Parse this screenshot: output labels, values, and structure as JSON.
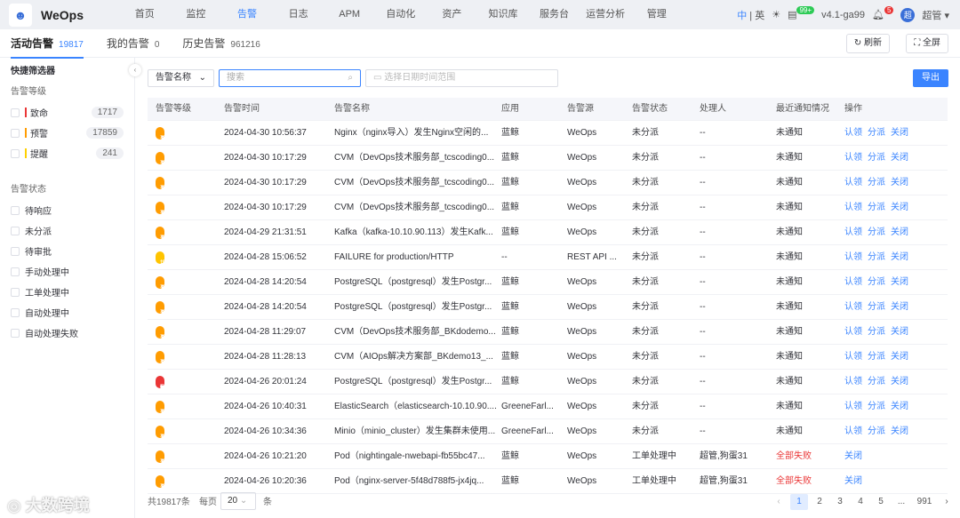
{
  "header": {
    "brand": "WeOps",
    "nav": [
      "首页",
      "监控",
      "告警",
      "日志",
      "APM",
      "自动化",
      "资产",
      "知识库",
      "服务台",
      "运营分析",
      "管理"
    ],
    "active_nav": "告警",
    "lang_zh": "中",
    "lang_sep": "|",
    "lang_en": "英",
    "msg_badge": "99+",
    "version": "v4.1-ga99",
    "notify_badge": "5",
    "avatar": "超",
    "user": "超管"
  },
  "tabs": [
    {
      "label": "活动告警",
      "count": "19817"
    },
    {
      "label": "我的告警",
      "count": "0"
    },
    {
      "label": "历史告警",
      "count": "961216"
    }
  ],
  "toolbar": {
    "refresh": "刷新",
    "fullscreen": "全屏",
    "export": "导出"
  },
  "sidebar": {
    "title": "快捷筛选器",
    "level_title": "告警等级",
    "levels": [
      {
        "label": "致命",
        "count": "1717",
        "color": "#ea3636"
      },
      {
        "label": "预警",
        "count": "17859",
        "color": "#ff9c01"
      },
      {
        "label": "提醒",
        "count": "241",
        "color": "#ffd000"
      }
    ],
    "status_title": "告警状态",
    "statuses": [
      "待响应",
      "未分派",
      "待审批",
      "手动处理中",
      "工单处理中",
      "自动处理中",
      "自动处理失败"
    ]
  },
  "filter": {
    "field": "告警名称",
    "search_placeholder": "搜索",
    "date_placeholder": "选择日期时间范围"
  },
  "table": {
    "columns": [
      "告警等级",
      "告警时间",
      "告警名称",
      "应用",
      "告警源",
      "告警状态",
      "处理人",
      "最近通知情况",
      "操作"
    ],
    "rows": [
      {
        "level": "预警",
        "time": "2024-04-30 10:56:37",
        "name": "Nginx（nginx导入）发生Nginx空闲的...",
        "app": "蓝鲸",
        "source": "WeOps",
        "status": "未分派",
        "handler": "--",
        "notify": "未通知",
        "ops": [
          "认领",
          "分派",
          "关闭"
        ]
      },
      {
        "level": "预警",
        "time": "2024-04-30 10:17:29",
        "name": "CVM（DevOps技术服务部_tcscoding0...",
        "app": "蓝鲸",
        "source": "WeOps",
        "status": "未分派",
        "handler": "--",
        "notify": "未通知",
        "ops": [
          "认领",
          "分派",
          "关闭"
        ]
      },
      {
        "level": "预警",
        "time": "2024-04-30 10:17:29",
        "name": "CVM（DevOps技术服务部_tcscoding0...",
        "app": "蓝鲸",
        "source": "WeOps",
        "status": "未分派",
        "handler": "--",
        "notify": "未通知",
        "ops": [
          "认领",
          "分派",
          "关闭"
        ]
      },
      {
        "level": "预警",
        "time": "2024-04-30 10:17:29",
        "name": "CVM（DevOps技术服务部_tcscoding0...",
        "app": "蓝鲸",
        "source": "WeOps",
        "status": "未分派",
        "handler": "--",
        "notify": "未通知",
        "ops": [
          "认领",
          "分派",
          "关闭"
        ]
      },
      {
        "level": "预警",
        "time": "2024-04-29 21:31:51",
        "name": "Kafka（kafka-10.10.90.113）发生Kafk...",
        "app": "蓝鲸",
        "source": "WeOps",
        "status": "未分派",
        "handler": "--",
        "notify": "未通知",
        "ops": [
          "认领",
          "分派",
          "关闭"
        ]
      },
      {
        "level": "提醒",
        "time": "2024-04-28 15:06:52",
        "name": "FAILURE for production/HTTP",
        "app": "--",
        "source": "REST API ...",
        "status": "未分派",
        "handler": "--",
        "notify": "未通知",
        "ops": [
          "认领",
          "分派",
          "关闭"
        ]
      },
      {
        "level": "预警",
        "time": "2024-04-28 14:20:54",
        "name": "PostgreSQL（postgresql）发生Postgr...",
        "app": "蓝鲸",
        "source": "WeOps",
        "status": "未分派",
        "handler": "--",
        "notify": "未通知",
        "ops": [
          "认领",
          "分派",
          "关闭"
        ]
      },
      {
        "level": "预警",
        "time": "2024-04-28 14:20:54",
        "name": "PostgreSQL（postgresql）发生Postgr...",
        "app": "蓝鲸",
        "source": "WeOps",
        "status": "未分派",
        "handler": "--",
        "notify": "未通知",
        "ops": [
          "认领",
          "分派",
          "关闭"
        ]
      },
      {
        "level": "预警",
        "time": "2024-04-28 11:29:07",
        "name": "CVM（DevOps技术服务部_BKdodemo...",
        "app": "蓝鲸",
        "source": "WeOps",
        "status": "未分派",
        "handler": "--",
        "notify": "未通知",
        "ops": [
          "认领",
          "分派",
          "关闭"
        ]
      },
      {
        "level": "预警",
        "time": "2024-04-28 11:28:13",
        "name": "CVM（AIOps解决方案部_BKdemo13_...",
        "app": "蓝鲸",
        "source": "WeOps",
        "status": "未分派",
        "handler": "--",
        "notify": "未通知",
        "ops": [
          "认领",
          "分派",
          "关闭"
        ]
      },
      {
        "level": "致命",
        "time": "2024-04-26 20:01:24",
        "name": "PostgreSQL（postgresql）发生Postgr...",
        "app": "蓝鲸",
        "source": "WeOps",
        "status": "未分派",
        "handler": "--",
        "notify": "未通知",
        "ops": [
          "认领",
          "分派",
          "关闭"
        ]
      },
      {
        "level": "预警",
        "time": "2024-04-26 10:40:31",
        "name": "ElasticSearch（elasticsearch-10.10.90....",
        "app": "GreeneFarl...",
        "source": "WeOps",
        "status": "未分派",
        "handler": "--",
        "notify": "未通知",
        "ops": [
          "认领",
          "分派",
          "关闭"
        ]
      },
      {
        "level": "预警",
        "time": "2024-04-26 10:34:36",
        "name": "Minio（minio_cluster）发生集群未使用...",
        "app": "GreeneFarl...",
        "source": "WeOps",
        "status": "未分派",
        "handler": "--",
        "notify": "未通知",
        "ops": [
          "认领",
          "分派",
          "关闭"
        ]
      },
      {
        "level": "预警",
        "time": "2024-04-26 10:21:20",
        "name": "Pod（nightingale-nwebapi-fb55bc47...",
        "app": "蓝鲸",
        "source": "WeOps",
        "status": "工单处理中",
        "handler": "超管,狗蛋31",
        "notify": "全部失败",
        "ops": [
          "关闭"
        ]
      },
      {
        "level": "预警",
        "time": "2024-04-26 10:20:36",
        "name": "Pod（nginx-server-5f48d788f5-jx4jq...",
        "app": "蓝鲸",
        "source": "WeOps",
        "status": "工单处理中",
        "handler": "超管,狗蛋31",
        "notify": "全部失败",
        "ops": [
          "关闭"
        ]
      }
    ]
  },
  "level_colors": {
    "致命": "#ea3636",
    "预警": "#ff9c01",
    "提醒": "#ffc400"
  },
  "pagination": {
    "total_prefix": "共",
    "total": "19817",
    "total_suffix": "条",
    "per_page_label": "每页",
    "per_page": "20",
    "per_page_suffix": "条",
    "pages": [
      "1",
      "2",
      "3",
      "4",
      "5",
      "...",
      "991"
    ],
    "current": "1"
  },
  "watermark": "大数跨境"
}
